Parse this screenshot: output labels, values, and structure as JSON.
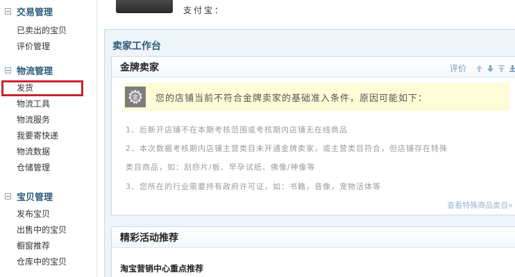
{
  "sidebar": {
    "sections": [
      {
        "title": "交易管理",
        "items": [
          "已卖出的宝贝",
          "评价管理"
        ]
      },
      {
        "title": "物流管理",
        "items": [
          "发货",
          "物流工具",
          "物流服务",
          "我要寄快递",
          "物流数据",
          "仓储管理"
        ]
      },
      {
        "title": "宝贝管理",
        "items": [
          "发布宝贝",
          "出售中的宝贝",
          "橱窗推荐",
          "仓库中的宝贝"
        ]
      }
    ]
  },
  "top": {
    "alipay_label": "支付宝："
  },
  "workbench": {
    "title": "卖家工作台",
    "gold_panel": {
      "title": "金牌卖家",
      "tools_label": "评价",
      "badge_glyph": "金",
      "notice": "您的店铺当前不符合金牌卖家的基础准入条件，原因可能如下：",
      "reasons": [
        "1、后新开店铺不在本期考核范围或考核期内店铺无在线商品",
        "2、本次数据考核期内店铺主营类目未开通金牌卖家，或主营类目符合，但店铺存在特殊",
        "类目商品，如：刮痧片/板、早孕试纸、佛像/神像等",
        "3、您所在的行业需要持有政府许可证，如：书籍，音像，宠物活体等"
      ],
      "link": "查看特殊商品类目»"
    },
    "activity_panel": {
      "title": "精彩活动推荐",
      "subtitle": "淘宝营销中心重点推荐"
    }
  },
  "colors": {
    "accent": "#2b5b7a",
    "active_outline": "#c8242d",
    "notice_bg": "#fefbd7"
  }
}
